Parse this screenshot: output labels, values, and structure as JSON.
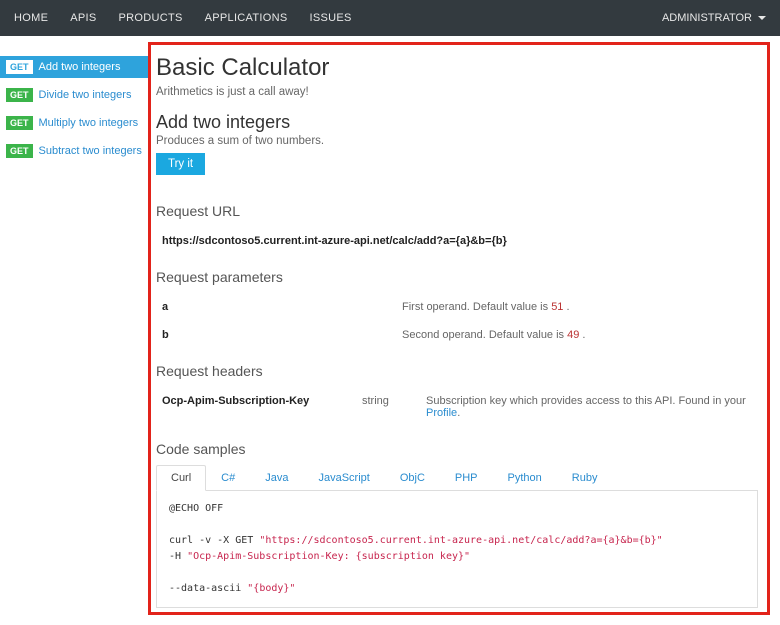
{
  "topnav": {
    "items": [
      "HOME",
      "APIS",
      "PRODUCTS",
      "APPLICATIONS",
      "ISSUES"
    ],
    "user": "ADMINISTRATOR"
  },
  "sidebar": {
    "items": [
      {
        "method": "GET",
        "label": "Add two integers",
        "active": true
      },
      {
        "method": "GET",
        "label": "Divide two integers",
        "active": false
      },
      {
        "method": "GET",
        "label": "Multiply two integers",
        "active": false
      },
      {
        "method": "GET",
        "label": "Subtract two integers",
        "active": false
      }
    ]
  },
  "page": {
    "title": "Basic Calculator",
    "tagline": "Arithmetics is just a call away!",
    "op_title": "Add two integers",
    "op_desc": "Produces a sum of two numbers.",
    "try_label": "Try it",
    "sections": {
      "request_url": "Request URL",
      "request_params": "Request parameters",
      "request_headers": "Request headers",
      "code_samples": "Code samples"
    },
    "request_url": "https://sdcontoso5.current.int-azure-api.net/calc/add?a={a}&b={b}",
    "params": [
      {
        "name": "a",
        "desc_prefix": "First operand. Default value is ",
        "default": "51"
      },
      {
        "name": "b",
        "desc_prefix": "Second operand. Default value is ",
        "default": "49"
      }
    ],
    "headers": [
      {
        "name": "Ocp-Apim-Subscription-Key",
        "type": "string",
        "desc": "Subscription key which provides access to this API. Found in your ",
        "link": "Profile"
      }
    ],
    "code_tabs": [
      "Curl",
      "C#",
      "Java",
      "JavaScript",
      "ObjC",
      "PHP",
      "Python",
      "Ruby"
    ],
    "code": {
      "l1": "@ECHO OFF",
      "l2a": "curl -v -X GET ",
      "l2b": "\"https://sdcontoso5.current.int-azure-api.net/calc/add?a={a}&b={b}\"",
      "l3a": "-H ",
      "l3b": "\"Ocp-Apim-Subscription-Key: {subscription key}\"",
      "l4a": "--data-ascii ",
      "l4b": "\"{body}\""
    }
  }
}
